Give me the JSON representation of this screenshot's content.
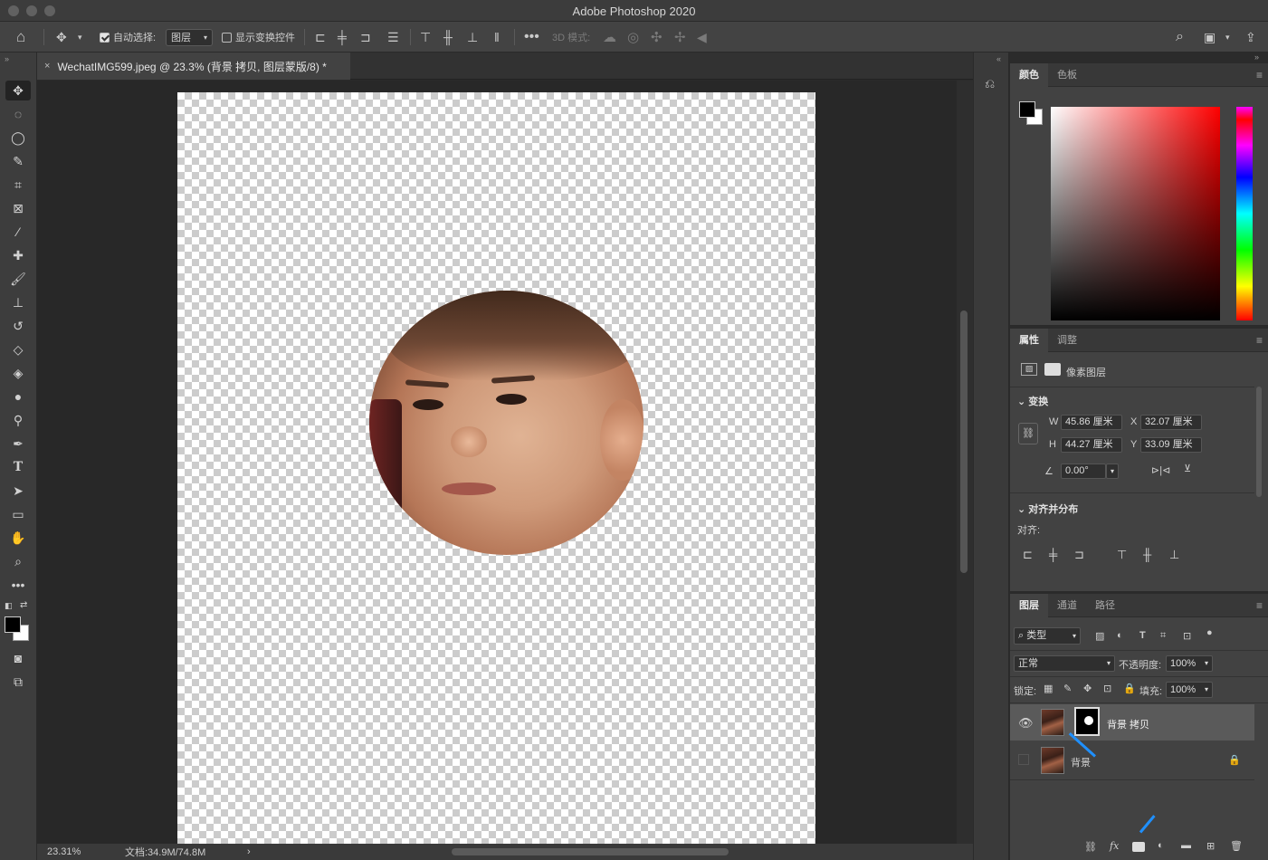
{
  "window": {
    "title": "Adobe Photoshop 2020"
  },
  "options_bar": {
    "auto_select_label": "自动选择:",
    "auto_select_value": "图层",
    "show_transform_label": "显示变换控件",
    "mode_3d_label": "3D 模式:"
  },
  "document": {
    "tab_title": "WechatIMG599.jpeg @ 23.3% (背景 拷贝, 图层蒙版/8) *",
    "close": "×"
  },
  "status": {
    "zoom": "23.31%",
    "doc_size": "文档:34.9M/74.8M",
    "more": "›"
  },
  "color_panel": {
    "tabs": [
      "颜色",
      "色板"
    ],
    "foreground": "#000000",
    "background": "#ffffff"
  },
  "properties_panel": {
    "tabs": [
      "属性",
      "调整"
    ],
    "pixel_layer_label": "像素图层",
    "transform_header": "变换",
    "w_label": "W",
    "w_value": "45.86 厘米",
    "x_label": "X",
    "x_value": "32.07 厘米",
    "h_label": "H",
    "h_value": "44.27 厘米",
    "y_label": "Y",
    "y_value": "33.09 厘米",
    "angle_value": "0.00°",
    "align_header": "对齐并分布",
    "align_label": "对齐:"
  },
  "layers_panel": {
    "tabs": [
      "图层",
      "通道",
      "路径"
    ],
    "filter_kind": "类型",
    "blend_mode": "正常",
    "opacity_label": "不透明度:",
    "opacity_value": "100%",
    "lock_label": "锁定:",
    "fill_label": "填充:",
    "fill_value": "100%",
    "layers": [
      {
        "name": "背景 拷贝",
        "visible": true,
        "has_mask": true,
        "selected": true
      },
      {
        "name": "背景",
        "visible": false,
        "locked": true
      }
    ]
  },
  "colors": {
    "accent_arrow": "#1f90ff"
  }
}
